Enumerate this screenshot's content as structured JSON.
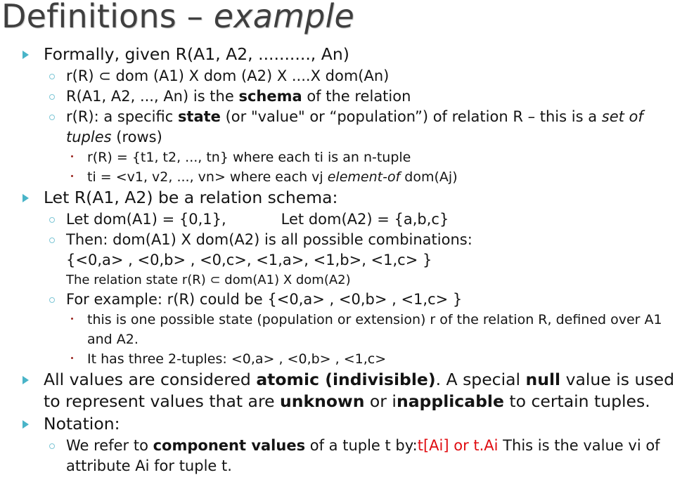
{
  "slide": {
    "title_main": "Definitions",
    "title_dash": " – ",
    "title_italic": "example",
    "accent_color": "#49b4c8",
    "bullet_level3_color": "#9a2620",
    "highlight_color": "#e00d12",
    "title_color": "#3f3f3f",
    "background_color": "#ffffff"
  },
  "bullets": {
    "formally": "Formally, given R(A1, A2, .........., An)",
    "rR_subset": "r(R) ⊂ dom (A1) X dom (A2) X ....X dom(An)",
    "schema_pre": "R(A1, A2, ..., An) is the ",
    "schema_bold": "schema",
    "schema_post": " of the relation",
    "state_pre": "r(R):  a specific ",
    "state_bold": "state",
    "state_mid": " (or \"value\" or “population”) of relation R – this is a ",
    "state_italic": "set of tuples",
    "state_post": " (rows)",
    "tuple_def": "r(R) = {t1, t2, ..., tn} where each ti is an n-tuple",
    "tuple_vals_pre": "ti = <v1, v2, ..., vn> where each vj ",
    "tuple_vals_italic": "element-of",
    "tuple_vals_post": " dom(Aj)",
    "let_schema": "Let R(A1, A2) be a relation schema:",
    "let_dom_a1": "Let dom(A1) = {0,1},",
    "let_dom_a2": "Let  dom(A2) =  {a,b,c}",
    "then_combinations": "Then: dom(A1) X dom(A2) is all possible combinations:",
    "combinations_set": "{<0,a> , <0,b> , <0,c>, <1,a>, <1,b>, <1,c> }",
    "relation_state_line": "The relation state r(R) ⊂ dom(A1) X dom(A2)",
    "for_example": "For example: r(R) could be {<0,a> , <0,b> , <1,c> }",
    "one_possible_state": "this is one possible state (population or extension) r of the relation R, defined over A1 and A2.",
    "three_tuples": "It has three 2-tuples: <0,a> , <0,b> , <1,c>",
    "atomic_pre": "All values are considered ",
    "atomic_bold": "atomic (indivisible)",
    "atomic_mid": ". A special ",
    "atomic_null": "null",
    "atomic_mid2": " value is used to represent values that are ",
    "atomic_unknown": "unknown",
    "atomic_or": " or i",
    "atomic_inapplicable": "napplicable",
    "atomic_post": " to certain tuples.",
    "notation": "Notation:",
    "component_pre": "We refer to ",
    "component_bold": "component values",
    "component_mid": " of a tuple t by:",
    "component_red": "t[Ai] or t.Ai",
    "component_post": " This is the value vi of attribute Ai for tuple t."
  }
}
